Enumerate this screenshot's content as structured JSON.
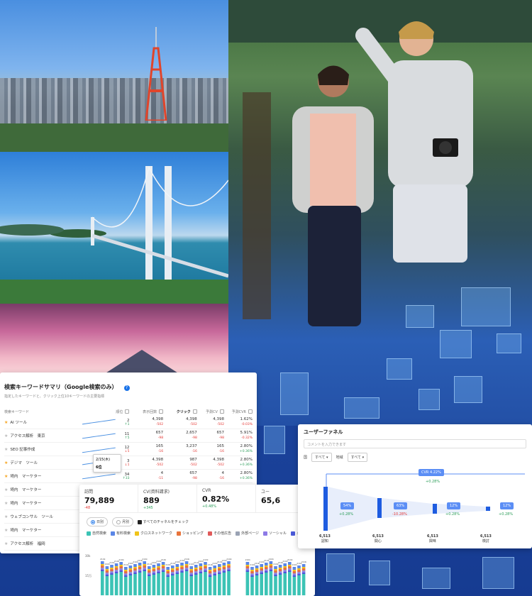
{
  "keyword_panel": {
    "title": "検索キーワードサマリ（Google検索のみ）",
    "subtitle": "指定したキーワードと、クリック上位10キーワードの主要指標",
    "columns": [
      "検索キーワード",
      "順位",
      "表示回数",
      "クリック",
      "予測CV",
      "予測CVR"
    ],
    "rows": [
      {
        "name": "AI ツール",
        "starred": true,
        "rank": "2",
        "rank_delta": "↑1",
        "impr": "4,398",
        "impr_delta": "-502",
        "clicks": "4,398",
        "clicks_delta": "-502",
        "cv": "4,398",
        "cv_delta": "-502",
        "cvr": "1.62%",
        "cvr_delta": "-0.03%"
      },
      {
        "name": "アクセス解析　東京",
        "starred": false,
        "rank": "11",
        "rank_delta": "↑5",
        "impr": "657",
        "impr_delta": "-98",
        "clicks": "2,657",
        "clicks_delta": "-98",
        "cv": "657",
        "cv_delta": "-98",
        "cvr": "5.91%",
        "cvr_delta": "-0.32%"
      },
      {
        "name": "SEO 記事作成",
        "starred": false,
        "rank": "12",
        "rank_delta": "↓5",
        "impr": "165",
        "impr_delta": "-16",
        "clicks": "3,237",
        "clicks_delta": "-16",
        "cv": "165",
        "cv_delta": "-16",
        "cvr": "2.80%",
        "cvr_delta": "+0.36%"
      },
      {
        "name": "デジマ　ツール",
        "starred": true,
        "rank": "3",
        "rank_delta": "↓1",
        "impr": "4,398",
        "impr_delta": "-502",
        "clicks": "987",
        "clicks_delta": "-502",
        "cv": "4,398",
        "cv_delta": "-502",
        "cvr": "2.80%",
        "cvr_delta": "+0.36%"
      },
      {
        "name": "埼内　マーケター",
        "starred": true,
        "rank": "34",
        "rank_delta": "↑33",
        "impr": "4",
        "impr_delta": "-11",
        "clicks": "657",
        "clicks_delta": "-98",
        "cv": "4",
        "cv_delta": "-16",
        "cvr": "2.80%",
        "cvr_delta": "+0.36%"
      },
      {
        "name": "埼内　マーケター",
        "starred": false,
        "rank": "",
        "rank_delta": "",
        "impr": "",
        "impr_delta": "",
        "clicks": "",
        "clicks_delta": "",
        "cv": "",
        "cv_delta": "",
        "cvr": "",
        "cvr_delta": ""
      },
      {
        "name": "埼内　マーケター",
        "starred": false,
        "rank": "",
        "rank_delta": "",
        "impr": "",
        "impr_delta": "",
        "clicks": "",
        "clicks_delta": "",
        "cv": "",
        "cv_delta": "",
        "cvr": "",
        "cvr_delta": ""
      },
      {
        "name": "ウェブコンサル　ツール",
        "starred": false,
        "rank": "",
        "rank_delta": "",
        "impr": "",
        "impr_delta": "",
        "clicks": "",
        "clicks_delta": "",
        "cv": "",
        "cv_delta": "",
        "cvr": "",
        "cvr_delta": ""
      },
      {
        "name": "埼内　マーケター",
        "starred": false,
        "rank": "",
        "rank_delta": "",
        "impr": "",
        "impr_delta": "",
        "clicks": "",
        "clicks_delta": "",
        "cv": "",
        "cv_delta": "",
        "cvr": "",
        "cvr_delta": ""
      },
      {
        "name": "アクセス解析　福岡",
        "starred": false,
        "rank": "",
        "rank_delta": "",
        "impr": "",
        "impr_delta": "",
        "clicks": "",
        "clicks_delta": "",
        "cv": "",
        "cv_delta": "",
        "cvr": "",
        "cvr_delta": ""
      }
    ],
    "tooltip": {
      "date": "2/15(木)",
      "rank": "6位"
    }
  },
  "metrics_panel": {
    "cards": [
      {
        "label": "訪問",
        "value": "79,889",
        "delta": "-48",
        "delta_color": "#e53935"
      },
      {
        "label": "CV(資料請求)",
        "value": "889",
        "delta": "+345",
        "delta_color": "#2e9e5b"
      },
      {
        "label": "CVR",
        "value": "0.82%",
        "delta": "+0.48%",
        "delta_color": "#2e9e5b"
      },
      {
        "label": "ユー",
        "value": "65,6",
        "delta": "",
        "delta_color": "#2e9e5b"
      }
    ],
    "toggle_daily": "日別",
    "toggle_monthly": "月別",
    "check_all": "すべてのチャネルをチェック",
    "channels": [
      {
        "label": "自然検索",
        "color": "#3cc3b5"
      },
      {
        "label": "有料検索",
        "color": "#5a86e6"
      },
      {
        "label": "クロスネットワーク",
        "color": "#f0c419"
      },
      {
        "label": "ショッピング",
        "color": "#e8743b"
      },
      {
        "label": "その他広告",
        "color": "#e05a5a"
      },
      {
        "label": "外部ページ",
        "color": "#9aa3b4"
      },
      {
        "label": "ソーシャル",
        "color": "#8d7ae6"
      },
      {
        "label": "メ",
        "color": "#4a5ad8"
      }
    ],
    "y_top_label": "30k",
    "y_mid_label": "15万",
    "bar_top_label": "210k"
  },
  "funnel_panel": {
    "title": "ユーザーファネル",
    "comment_placeholder": "コメントを入力できます",
    "filter1_label": "国",
    "filter1_value": "すべて",
    "filter2_label": "地域",
    "filter2_value": "すべて",
    "cvr_label": "CVR 4.22%",
    "cvr_delta": "+0.28%",
    "steps": [
      {
        "rate": "54%",
        "delta": "+0.28%",
        "delta_color": "#2e9e5b",
        "count": "6,513",
        "name": "認知"
      },
      {
        "rate": "63%",
        "delta": "-10.28%",
        "delta_color": "#e53935",
        "count": "6,513",
        "name": "関心"
      },
      {
        "rate": "12%",
        "delta": "+0.28%",
        "delta_color": "#2e9e5b",
        "count": "6,513",
        "name": "興味"
      },
      {
        "rate": "12%",
        "delta": "+0.28%",
        "delta_color": "#2e9e5b",
        "count": "6,513",
        "name": "検討"
      }
    ],
    "first_count": "6,513",
    "first_name": "認知"
  }
}
